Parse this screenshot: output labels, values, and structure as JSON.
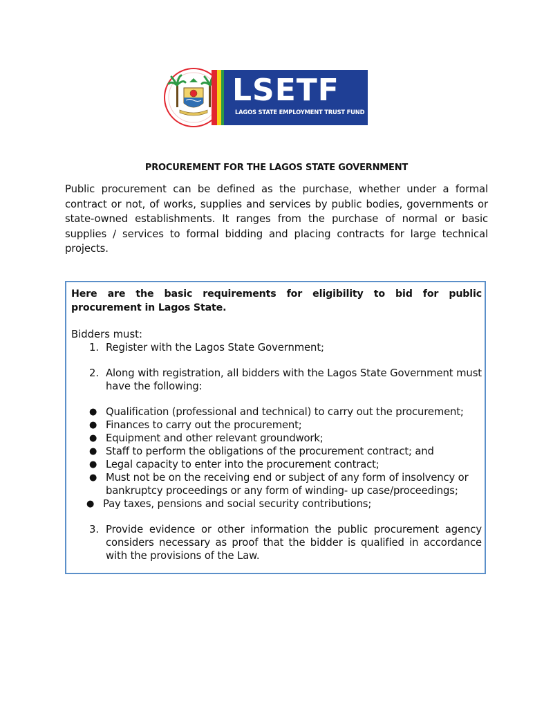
{
  "logo": {
    "wordmark": "LSETF",
    "tagline": "LAGOS STATE EMPLOYMENT TRUST FUND",
    "colors": {
      "navy": "#1f3f95",
      "red": "#e2262f",
      "yellow": "#f7d117",
      "green": "#2e9a45"
    }
  },
  "title": "PROCUREMENT FOR THE LAGOS STATE GOVERNMENT",
  "intro": "Public procurement can be defined as the purchase, whether under a formal contract or not, of works, supplies and services by public bodies, governments or state-owned establishments. It ranges from the purchase of normal or basic supplies / services to formal bidding and placing contracts for large technical projects.",
  "box": {
    "heading": "Here are the basic requirements for eligibility to bid for public procurement in Lagos State.",
    "lead": "Bidders must:",
    "items": [
      {
        "num": "1.",
        "text": "Register with the Lagos State Government;"
      },
      {
        "num": "2.",
        "text": "Along with registration, all bidders with the Lagos State Government must have the following:"
      },
      {
        "num": "3.",
        "text": "Provide evidence or other information the public procurement agency considers necessary as proof that the bidder is qualified in accordance with the provisions of the Law."
      }
    ],
    "bullets": [
      "Qualification (professional and technical) to carry out the procurement;",
      "Finances to carry out the procurement;",
      "Equipment and other relevant groundwork;",
      "Staff to perform the obligations of the procurement contract; and",
      "Legal capacity to enter into the procurement contract;",
      "Must not be on the receiving end or subject of any form of insolvency or bankruptcy proceedings or any form of winding- up case/proceedings;",
      "Pay taxes, pensions and social security contributions;"
    ],
    "border_color": "#5b8fc9"
  }
}
